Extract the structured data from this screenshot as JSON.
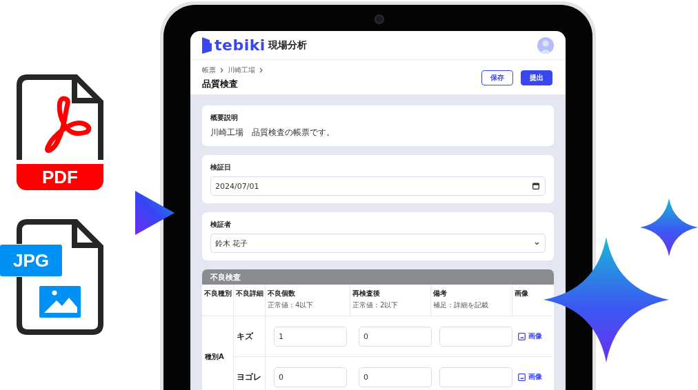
{
  "files": [
    {
      "kind": "pdf",
      "label": "PDF"
    },
    {
      "kind": "jpg",
      "label": "JPG"
    }
  ],
  "app": {
    "brand": "tebiki",
    "product": "現場分析"
  },
  "breadcrumb": [
    "帳票",
    "川崎工場"
  ],
  "title": "品質検査",
  "buttons": [
    {
      "label": "保存",
      "kind": "outline"
    },
    {
      "label": "提出",
      "kind": "primary"
    }
  ],
  "summary": {
    "label": "概要説明",
    "text": "川崎工場　品質検査の帳票です。"
  },
  "date_field": {
    "label": "検証日",
    "value": "2024/07/01"
  },
  "inspector_field": {
    "label": "検証者",
    "value": "鈴木 花子"
  },
  "defect_table": {
    "title": "不良検査",
    "columns": [
      {
        "name": "不良種別"
      },
      {
        "name": "不良詳細"
      },
      {
        "name": "不良個数",
        "note": "正常値：4以下"
      },
      {
        "name": "再検査後",
        "note": "正常値：2以下"
      },
      {
        "name": "備考",
        "note": "補足：詳細を記載"
      },
      {
        "name": "画像"
      }
    ],
    "groups": [
      {
        "name": "種別A",
        "rows": [
          {
            "detail": "キズ",
            "count": "1",
            "recheck": "0",
            "image_link": "画像"
          },
          {
            "detail": "ヨゴレ",
            "count": "0",
            "recheck": "0",
            "image_link": "画像"
          }
        ]
      }
    ]
  }
}
